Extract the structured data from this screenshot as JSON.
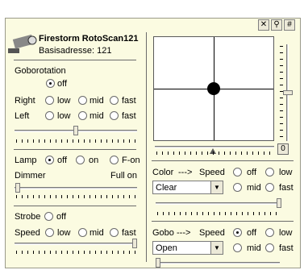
{
  "window": {
    "buttons": [
      {
        "icon": "close-icon",
        "glyph": "✕"
      },
      {
        "icon": "pin-icon",
        "glyph": "⚲"
      },
      {
        "icon": "grid-icon",
        "glyph": "#"
      }
    ]
  },
  "device": {
    "name": "Firestorm RotoScan121",
    "address": "Basisadresse: 121"
  },
  "gobo_rotation": {
    "title": "Goborotation",
    "off_label": "off",
    "right_label": "Right",
    "left_label": "Left",
    "speed_options": [
      "low",
      "mid",
      "fast"
    ],
    "slider_value": 0.5
  },
  "lamp": {
    "label": "Lamp",
    "options": [
      "off",
      "on",
      "F-on"
    ],
    "selected": "off",
    "dimmer_label": "Dimmer",
    "full_label": "Full on",
    "dimmer_value": 0.0
  },
  "strobe": {
    "label": "Strobe",
    "off_label": "off",
    "speed_label": "Speed",
    "speed_options": [
      "low",
      "mid",
      "fast"
    ],
    "slider_value": 0.97
  },
  "position": {
    "pan_value": 0.5,
    "tilt_value": 0.5,
    "fine_pan_value": 0.5,
    "fine_tilt_value": 0.5,
    "zero_label": "0"
  },
  "color": {
    "label": "Color",
    "arrow": "--->",
    "speed_label": "Speed",
    "options": [
      "off",
      "low",
      "mid",
      "fast"
    ],
    "selected_value": "Clear",
    "slider_value": 1.0
  },
  "gobo": {
    "label": "Gobo",
    "arrow": "--->",
    "speed_label": "Speed",
    "options": [
      "off",
      "low",
      "mid",
      "fast"
    ],
    "selected_speed": "off",
    "selected_value": "Open",
    "slider_value": 0.0
  }
}
